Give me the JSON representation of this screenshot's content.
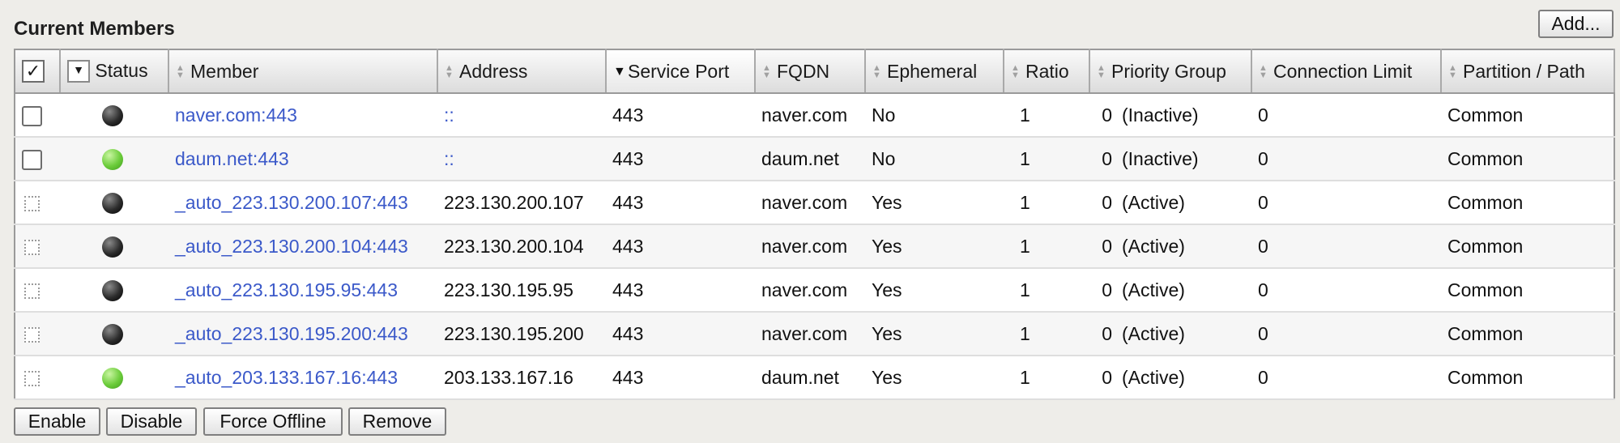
{
  "section_title": "Current Members",
  "add_button": "Add...",
  "columns": {
    "status": "Status",
    "member": "Member",
    "address": "Address",
    "service_port": "Service Port",
    "fqdn": "FQDN",
    "ephemeral": "Ephemeral",
    "ratio": "Ratio",
    "priority_group": "Priority Group",
    "connection_limit": "Connection Limit",
    "partition_path": "Partition / Path"
  },
  "header_checkbox": "✓",
  "rows": [
    {
      "selectable": true,
      "status_color": "black",
      "member": "naver.com:443",
      "address": "::",
      "service_port": "443",
      "fqdn": "naver.com",
      "ephemeral": "No",
      "ratio": "1",
      "priority_num": "0",
      "priority_state": "(Inactive)",
      "connection_limit": "0",
      "partition": "Common"
    },
    {
      "selectable": true,
      "status_color": "green",
      "member": "daum.net:443",
      "address": "::",
      "service_port": "443",
      "fqdn": "daum.net",
      "ephemeral": "No",
      "ratio": "1",
      "priority_num": "0",
      "priority_state": "(Inactive)",
      "connection_limit": "0",
      "partition": "Common"
    },
    {
      "selectable": false,
      "status_color": "black",
      "member": "_auto_223.130.200.107:443",
      "address": "223.130.200.107",
      "service_port": "443",
      "fqdn": "naver.com",
      "ephemeral": "Yes",
      "ratio": "1",
      "priority_num": "0",
      "priority_state": "(Active)",
      "connection_limit": "0",
      "partition": "Common"
    },
    {
      "selectable": false,
      "status_color": "black",
      "member": "_auto_223.130.200.104:443",
      "address": "223.130.200.104",
      "service_port": "443",
      "fqdn": "naver.com",
      "ephemeral": "Yes",
      "ratio": "1",
      "priority_num": "0",
      "priority_state": "(Active)",
      "connection_limit": "0",
      "partition": "Common"
    },
    {
      "selectable": false,
      "status_color": "black",
      "member": "_auto_223.130.195.95:443",
      "address": "223.130.195.95",
      "service_port": "443",
      "fqdn": "naver.com",
      "ephemeral": "Yes",
      "ratio": "1",
      "priority_num": "0",
      "priority_state": "(Active)",
      "connection_limit": "0",
      "partition": "Common"
    },
    {
      "selectable": false,
      "status_color": "black",
      "member": "_auto_223.130.195.200:443",
      "address": "223.130.195.200",
      "service_port": "443",
      "fqdn": "naver.com",
      "ephemeral": "Yes",
      "ratio": "1",
      "priority_num": "0",
      "priority_state": "(Active)",
      "connection_limit": "0",
      "partition": "Common"
    },
    {
      "selectable": false,
      "status_color": "green",
      "member": "_auto_203.133.167.16:443",
      "address": "203.133.167.16",
      "service_port": "443",
      "fqdn": "daum.net",
      "ephemeral": "Yes",
      "ratio": "1",
      "priority_num": "0",
      "priority_state": "(Active)",
      "connection_limit": "0",
      "partition": "Common"
    }
  ],
  "actions": {
    "enable": "Enable",
    "disable": "Disable",
    "force_offline": "Force Offline",
    "remove": "Remove"
  },
  "colors": {
    "link": "#3b59c9",
    "status_black": "#1a1a1a",
    "status_green": "#6bcc3a",
    "background": "#eeede9"
  },
  "icons": {
    "sort_both": "sort-arrows-icon",
    "sort_desc": "sort-descending-icon",
    "status_up": "green-circle-status-icon",
    "status_unknown": "black-circle-status-icon"
  }
}
